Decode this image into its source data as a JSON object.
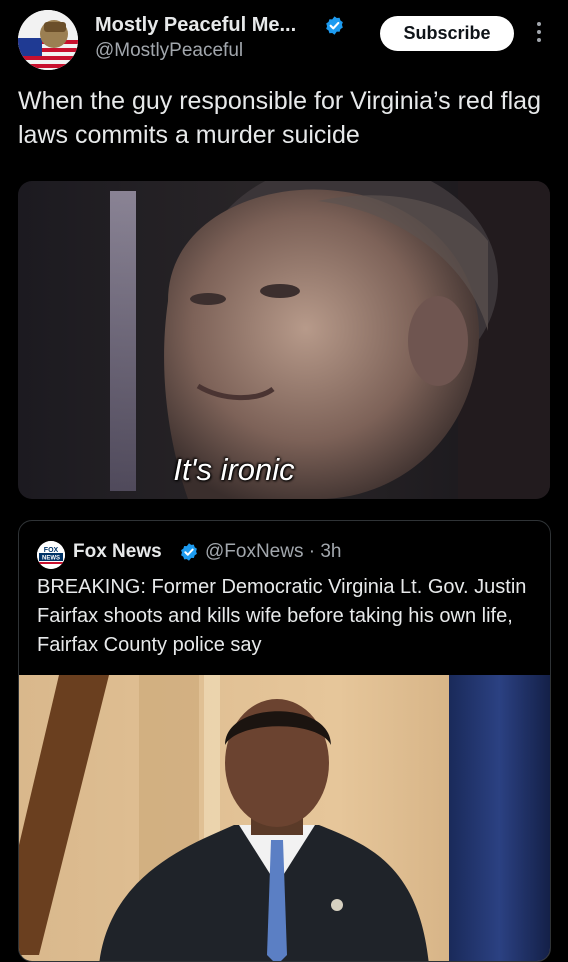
{
  "author": {
    "display_name": "Mostly Peaceful Me...",
    "handle": "@MostlyPeaceful",
    "subscribe_label": "Subscribe"
  },
  "post": {
    "text": "When the guy responsible for Virginia’s red flag laws commits a murder suicide"
  },
  "meme": {
    "caption": "It's ironic"
  },
  "quoted": {
    "display_name": "Fox News",
    "handle_time": "@FoxNews · 3h",
    "avatar_text": "FOX NEWS",
    "text": "BREAKING: Former Democratic Virginia Lt. Gov. Justin Fairfax shoots and kills wife before taking his own life, Fairfax County police say"
  },
  "colors": {
    "background": "#000000",
    "text": "#e7e9ea",
    "secondary_text": "#a2a7ad",
    "verified": "#1d9bf0",
    "border": "#2f3336"
  },
  "icons": {
    "verified": "verified-badge-icon",
    "more": "more-vertical-icon"
  }
}
